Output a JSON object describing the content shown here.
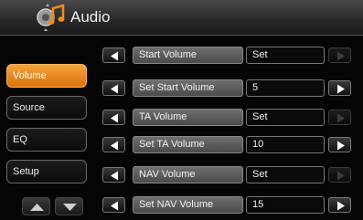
{
  "header": {
    "title": "Audio",
    "icon": "audio-settings-icon"
  },
  "sidebar": {
    "items": [
      {
        "label": "Volume",
        "active": true
      },
      {
        "label": "Source",
        "active": false
      },
      {
        "label": "EQ",
        "active": false
      },
      {
        "label": "Setup",
        "active": false
      }
    ],
    "scroll_up_icon": "triangle-up-icon",
    "scroll_down_icon": "triangle-down-icon"
  },
  "settings": {
    "rows": [
      {
        "label": "Start Volume",
        "value": "Set",
        "right_enabled": false
      },
      {
        "label": "Set Start Volume",
        "value": "5",
        "right_enabled": true
      },
      {
        "label": "TA Volume",
        "value": "Set",
        "right_enabled": false
      },
      {
        "label": "Set TA Volume",
        "value": "10",
        "right_enabled": true
      },
      {
        "label": "NAV Volume",
        "value": "Set",
        "right_enabled": false
      },
      {
        "label": "Set NAV Volume",
        "value": "15",
        "right_enabled": true
      }
    ]
  },
  "colors": {
    "accent": "#f08a1f",
    "background": "#050505"
  }
}
